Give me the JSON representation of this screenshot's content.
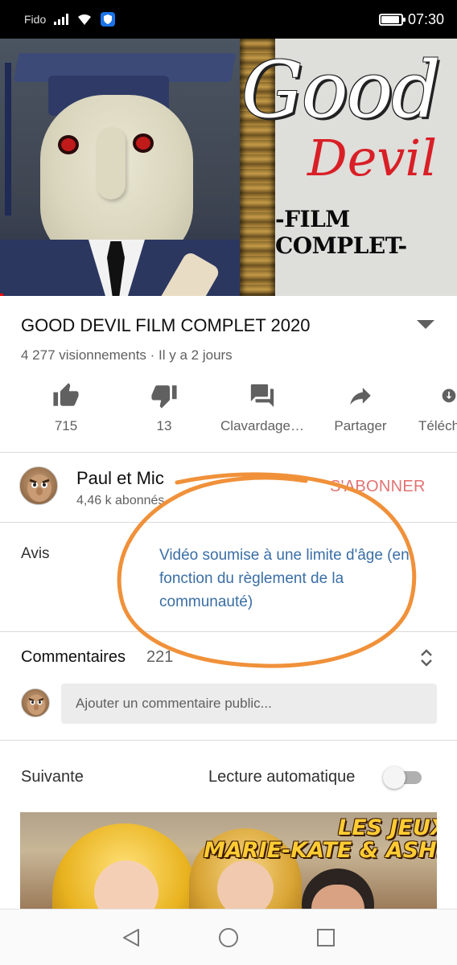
{
  "status_bar": {
    "carrier": "Fido",
    "time": "07:30",
    "battery_level": 0.9
  },
  "thumbnail": {
    "title_good": "Good",
    "title_devil": "Devil",
    "title_film": "-FILM COMPLET-"
  },
  "video": {
    "title": "GOOD DEVIL FILM COMPLET 2020",
    "meta": "4 277 visionnements · Il y a 2 jours"
  },
  "actions": [
    {
      "icon": "thumbs-up-icon",
      "label": "715"
    },
    {
      "icon": "thumbs-down-icon",
      "label": "13"
    },
    {
      "icon": "chat-icon",
      "label": "Clavardage…"
    },
    {
      "icon": "share-icon",
      "label": "Partager"
    },
    {
      "icon": "download-icon",
      "label": "Téléch"
    }
  ],
  "channel": {
    "name": "Paul et Mic",
    "subscribers": "4,46 k abonnés",
    "subscribe_label": "S'ABONNER"
  },
  "notice": {
    "label": "Avis",
    "text": "Vidéo soumise à une limite d'âge (en fonction du règlement de la communauté)"
  },
  "comments": {
    "label": "Commentaires",
    "count": "221",
    "placeholder": "Ajouter un commentaire public..."
  },
  "up_next": {
    "label": "Suivante",
    "autoplay_label": "Lecture automatique",
    "autoplay_on": false,
    "thumb_line1": "LES JEUX",
    "thumb_line2": "MARIE-KATE & ASHLEY"
  },
  "colors": {
    "accent_red": "#cc0000",
    "link_blue": "#3a6ea5",
    "annotation_orange": "#f0913a"
  }
}
